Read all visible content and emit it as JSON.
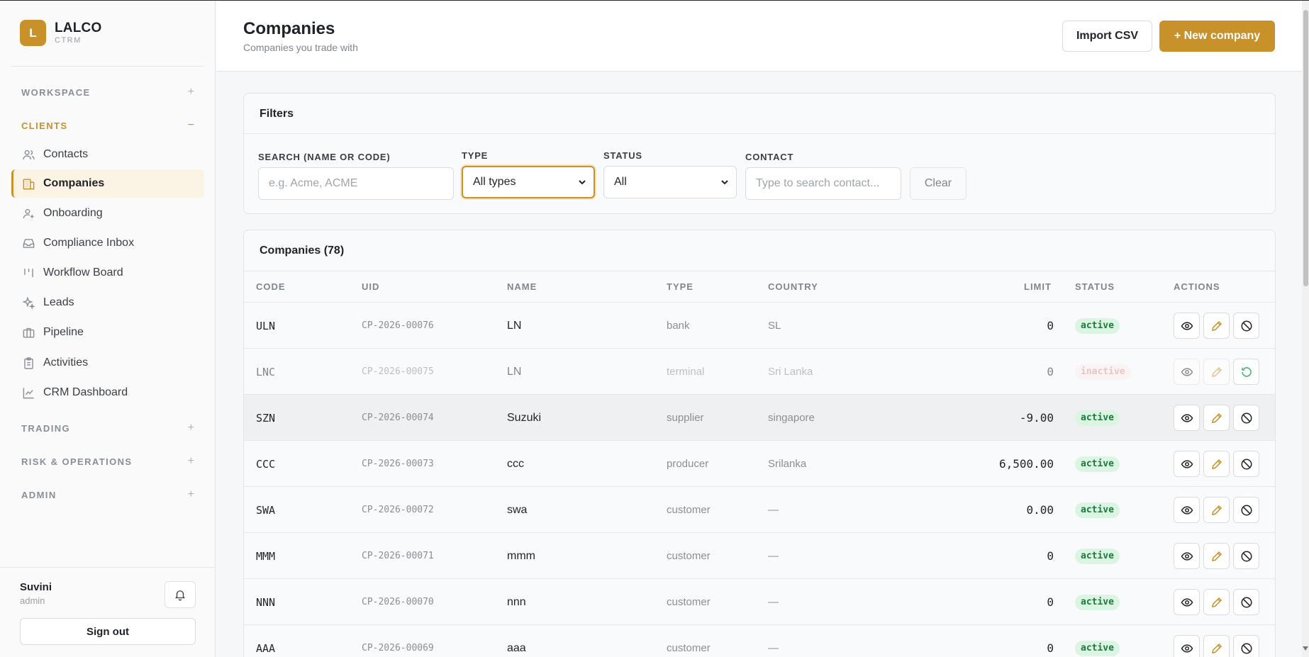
{
  "brand": {
    "name": "LALCO",
    "sub": "CTRM",
    "logo_letter": "L",
    "accent": "#c8912a"
  },
  "sidebar": {
    "sections": {
      "workspace": "WORKSPACE",
      "clients": "CLIENTS",
      "trading": "TRADING",
      "risk": "RISK & OPERATIONS",
      "admin": "ADMIN"
    },
    "items": [
      {
        "label": "Contacts",
        "icon": "users-icon"
      },
      {
        "label": "Companies",
        "icon": "building-icon",
        "active": true
      },
      {
        "label": "Onboarding",
        "icon": "user-plus-icon"
      },
      {
        "label": "Compliance Inbox",
        "icon": "inbox-icon"
      },
      {
        "label": "Workflow Board",
        "icon": "kanban-icon"
      },
      {
        "label": "Leads",
        "icon": "sparkle-icon"
      },
      {
        "label": "Pipeline",
        "icon": "briefcase-icon"
      },
      {
        "label": "Activities",
        "icon": "clipboard-icon"
      },
      {
        "label": "CRM Dashboard",
        "icon": "chart-line-icon"
      }
    ]
  },
  "user": {
    "name": "Suvini",
    "role": "admin",
    "sign_out": "Sign out"
  },
  "header": {
    "title": "Companies",
    "subtitle": "Companies you trade with",
    "import_label": "Import CSV",
    "new_label": "+ New company"
  },
  "filters": {
    "title": "Filters",
    "search_label": "SEARCH (NAME OR CODE)",
    "search_placeholder": "e.g. Acme, ACME",
    "type_label": "TYPE",
    "type_value": "All types",
    "status_label": "STATUS",
    "status_value": "All",
    "contact_label": "CONTACT",
    "contact_placeholder": "Type to search contact...",
    "clear_label": "Clear"
  },
  "table": {
    "title": "Companies (78)",
    "columns": {
      "code": "CODE",
      "uid": "UID",
      "name": "NAME",
      "type": "TYPE",
      "country": "COUNTRY",
      "limit": "LIMIT",
      "status": "STATUS",
      "actions": "ACTIONS"
    },
    "rows": [
      {
        "code": "ULN",
        "uid": "CP-2026-00076",
        "name": "LN",
        "type": "bank",
        "country": "SL",
        "limit": "0",
        "status": "active"
      },
      {
        "code": "LNC",
        "uid": "CP-2026-00075",
        "name": "LN",
        "type": "terminal",
        "country": "Sri Lanka",
        "limit": "0",
        "status": "inactive"
      },
      {
        "code": "SZN",
        "uid": "CP-2026-00074",
        "name": "Suzuki",
        "type": "supplier",
        "country": "singapore",
        "limit": "-9.00",
        "status": "active"
      },
      {
        "code": "CCC",
        "uid": "CP-2026-00073",
        "name": "ccc",
        "type": "producer",
        "country": "Srilanka",
        "limit": "6,500.00",
        "status": "active"
      },
      {
        "code": "SWA",
        "uid": "CP-2026-00072",
        "name": "swa",
        "type": "customer",
        "country": "—",
        "limit": "0.00",
        "status": "active"
      },
      {
        "code": "MMM",
        "uid": "CP-2026-00071",
        "name": "mmm",
        "type": "customer",
        "country": "—",
        "limit": "0",
        "status": "active"
      },
      {
        "code": "NNN",
        "uid": "CP-2026-00070",
        "name": "nnn",
        "type": "customer",
        "country": "—",
        "limit": "0",
        "status": "active"
      },
      {
        "code": "AAA",
        "uid": "CP-2026-00069",
        "name": "aaa",
        "type": "customer",
        "country": "—",
        "limit": "0",
        "status": "active"
      }
    ]
  }
}
